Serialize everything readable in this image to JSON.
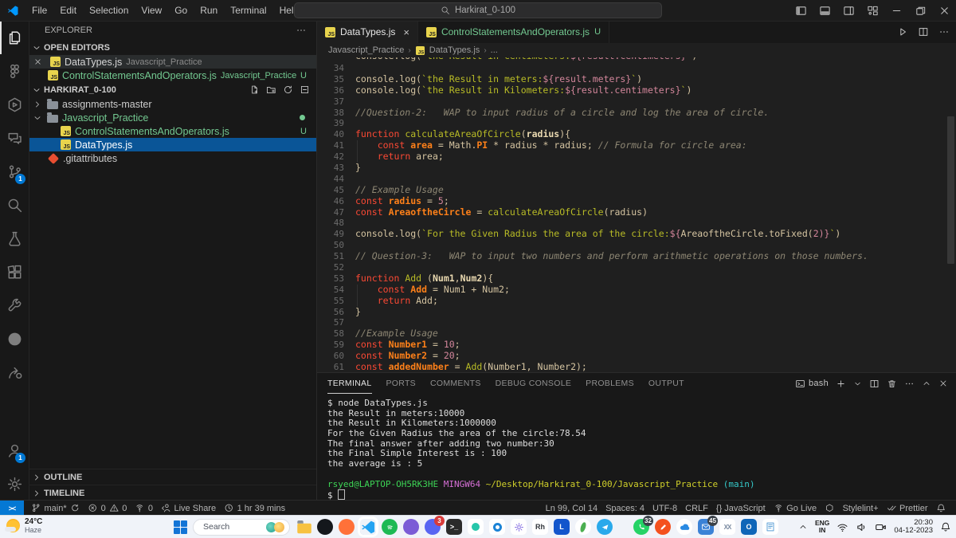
{
  "titlebar": {
    "menus": [
      "File",
      "Edit",
      "Selection",
      "View",
      "Go",
      "Run",
      "Terminal",
      "Help"
    ],
    "back_arrow": "←",
    "forward_arrow": "→",
    "search": "Harkirat_0-100"
  },
  "activity_bar": {
    "items": [
      {
        "name": "explorer",
        "icon": "files",
        "active": true
      },
      {
        "name": "figma",
        "icon": "figma"
      },
      {
        "name": "hexagon-app",
        "icon": "hexagon"
      },
      {
        "name": "chat",
        "icon": "chat"
      },
      {
        "name": "source-control",
        "icon": "scm",
        "badge": "1"
      },
      {
        "name": "search",
        "icon": "search"
      },
      {
        "name": "testing",
        "icon": "beaker"
      },
      {
        "name": "extensions",
        "icon": "extensions"
      },
      {
        "name": "remote-tools",
        "icon": "tools"
      },
      {
        "name": "github",
        "icon": "github"
      },
      {
        "name": "live-share",
        "icon": "share"
      }
    ],
    "bottom": [
      {
        "name": "accounts",
        "icon": "account",
        "badge": "1"
      },
      {
        "name": "settings",
        "icon": "gear"
      }
    ]
  },
  "sidebar": {
    "title": "EXPLORER",
    "open_editors": {
      "label": "OPEN EDITORS",
      "items": [
        {
          "file": "DataTypes.js",
          "desc": "Javascript_Practice",
          "closable": true,
          "green": false,
          "badge": ""
        },
        {
          "file": "ControlStatementsAndOperators.js",
          "desc": "Javascript_Practice",
          "closable": false,
          "green": true,
          "badge": "U"
        }
      ]
    },
    "workspace": {
      "label": "HARKIRAT_0-100",
      "tree": [
        {
          "label": "assignments-master",
          "kind": "folder",
          "chev": "r",
          "indent": 4
        },
        {
          "label": "Javascript_Practice",
          "kind": "folder",
          "chev": "d",
          "indent": 4,
          "green": true,
          "dot": true
        },
        {
          "label": "ControlStatementsAndOperators.js",
          "kind": "js",
          "indent": 40,
          "green": true,
          "badge": "U"
        },
        {
          "label": "DataTypes.js",
          "kind": "js",
          "indent": 40,
          "selected": true
        },
        {
          "label": ".gitattributes",
          "kind": "git",
          "indent": 24
        }
      ]
    },
    "outline_label": "OUTLINE",
    "timeline_label": "TIMELINE"
  },
  "editor": {
    "tabs": [
      {
        "label": "DataTypes.js",
        "active": true,
        "close": "×",
        "green": false,
        "badge": ""
      },
      {
        "label": "ControlStatementsAndOperators.js",
        "active": false,
        "close": "",
        "green": true,
        "badge": "U"
      }
    ],
    "breadcrumbs": [
      "Javascript_Practice",
      "DataTypes.js",
      "..."
    ],
    "code": [
      {
        "n": "",
        "clip": true,
        "seg": [
          [
            "console.log(",
            "pl"
          ],
          [
            "`the Result in centimeters:",
            "st"
          ],
          [
            "${result.centimeters}",
            "tp"
          ],
          [
            "`)",
            "pl"
          ]
        ]
      },
      {
        "n": 34,
        "seg": []
      },
      {
        "n": 35,
        "seg": [
          [
            "console.log(",
            "pl"
          ],
          [
            "`the Result in meters:",
            "st"
          ],
          [
            "${result.meters}",
            "tp"
          ],
          [
            "`",
            "st"
          ],
          [
            ")",
            "pl"
          ]
        ]
      },
      {
        "n": 36,
        "seg": [
          [
            "console.log(",
            "pl"
          ],
          [
            "`the Result in Kilometers:",
            "st"
          ],
          [
            "${result.centimeters}",
            "tp"
          ],
          [
            "`",
            "st"
          ],
          [
            ")",
            "pl"
          ]
        ]
      },
      {
        "n": 37,
        "seg": []
      },
      {
        "n": 38,
        "seg": [
          [
            "//Question-2:   WAP to input radius of a circle and log the area of circle.",
            "cm"
          ]
        ]
      },
      {
        "n": 39,
        "seg": []
      },
      {
        "n": 40,
        "seg": [
          [
            "function",
            "kw"
          ],
          [
            " ",
            "pl"
          ],
          [
            "calculateAreaOfCircle",
            "fn"
          ],
          [
            "(",
            "pl"
          ],
          [
            "radius",
            "pr"
          ],
          [
            "){",
            "pl"
          ]
        ]
      },
      {
        "n": 41,
        "g": true,
        "seg": [
          [
            "    ",
            "pl"
          ],
          [
            "const",
            "kw"
          ],
          [
            " ",
            "pl"
          ],
          [
            "area",
            "vr"
          ],
          [
            " = ",
            "pl"
          ],
          [
            "Math.",
            "pl"
          ],
          [
            "PI",
            "vr"
          ],
          [
            " * radius * radius; ",
            "pl"
          ],
          [
            "// Formula for circle area:",
            "cm"
          ]
        ]
      },
      {
        "n": 42,
        "g": true,
        "seg": [
          [
            "    ",
            "pl"
          ],
          [
            "return",
            "kw"
          ],
          [
            " area;",
            "pl"
          ]
        ]
      },
      {
        "n": 43,
        "seg": [
          [
            "}",
            "pl"
          ]
        ]
      },
      {
        "n": 44,
        "seg": []
      },
      {
        "n": 45,
        "seg": [
          [
            "// Example Usage",
            "cm"
          ]
        ]
      },
      {
        "n": 46,
        "seg": [
          [
            "const",
            "kw"
          ],
          [
            " ",
            "pl"
          ],
          [
            "radius",
            "vr"
          ],
          [
            " = ",
            "pl"
          ],
          [
            "5",
            "nm"
          ],
          [
            ";",
            "pl"
          ]
        ]
      },
      {
        "n": 47,
        "seg": [
          [
            "const",
            "kw"
          ],
          [
            " ",
            "pl"
          ],
          [
            "AreaoftheCircle",
            "vr"
          ],
          [
            " = ",
            "pl"
          ],
          [
            "calculateAreaOfCircle",
            "fn"
          ],
          [
            "(radius)",
            "pl"
          ]
        ]
      },
      {
        "n": 48,
        "seg": []
      },
      {
        "n": 49,
        "seg": [
          [
            "console.log(",
            "pl"
          ],
          [
            "`For the Given Radius the area of the circle:",
            "st"
          ],
          [
            "${",
            "tp"
          ],
          [
            "AreaoftheCircle.toFixed(",
            "pl"
          ],
          [
            "2",
            "nm"
          ],
          [
            ")}",
            "tp"
          ],
          [
            "`",
            "st"
          ],
          [
            ")",
            "pl"
          ]
        ]
      },
      {
        "n": 50,
        "seg": []
      },
      {
        "n": 51,
        "seg": [
          [
            "// Question-3:   WAP to input two numbers and perform arithmetic operations on those numbers.",
            "cm"
          ]
        ]
      },
      {
        "n": 52,
        "seg": []
      },
      {
        "n": 53,
        "seg": [
          [
            "function",
            "kw"
          ],
          [
            " ",
            "pl"
          ],
          [
            "Add",
            "fn"
          ],
          [
            " (",
            "pl"
          ],
          [
            "Num1",
            "pr"
          ],
          [
            ",",
            "pl"
          ],
          [
            "Num2",
            "pr"
          ],
          [
            "){",
            "pl"
          ]
        ]
      },
      {
        "n": 54,
        "g": true,
        "seg": [
          [
            "    ",
            "pl"
          ],
          [
            "const",
            "kw"
          ],
          [
            " ",
            "pl"
          ],
          [
            "Add",
            "vr"
          ],
          [
            " = Num1 + Num2;",
            "pl"
          ]
        ]
      },
      {
        "n": 55,
        "g": true,
        "seg": [
          [
            "    ",
            "pl"
          ],
          [
            "return",
            "kw"
          ],
          [
            " Add;",
            "pl"
          ]
        ]
      },
      {
        "n": 56,
        "seg": [
          [
            "}",
            "pl"
          ]
        ]
      },
      {
        "n": 57,
        "seg": []
      },
      {
        "n": 58,
        "seg": [
          [
            "//Example Usage",
            "cm"
          ]
        ]
      },
      {
        "n": 59,
        "seg": [
          [
            "const",
            "kw"
          ],
          [
            " ",
            "pl"
          ],
          [
            "Number1",
            "vr"
          ],
          [
            " = ",
            "pl"
          ],
          [
            "10",
            "nm"
          ],
          [
            ";",
            "pl"
          ]
        ]
      },
      {
        "n": 60,
        "seg": [
          [
            "const",
            "kw"
          ],
          [
            " ",
            "pl"
          ],
          [
            "Number2",
            "vr"
          ],
          [
            " = ",
            "pl"
          ],
          [
            "20",
            "nm"
          ],
          [
            ";",
            "pl"
          ]
        ]
      },
      {
        "n": 61,
        "seg": [
          [
            "const",
            "kw"
          ],
          [
            " ",
            "pl"
          ],
          [
            "addedNumber",
            "vr"
          ],
          [
            " = ",
            "pl"
          ],
          [
            "Add",
            "fn"
          ],
          [
            "(Number1, Number2);",
            "pl"
          ]
        ]
      }
    ]
  },
  "terminal": {
    "tabs": [
      "TERMINAL",
      "PORTS",
      "COMMENTS",
      "DEBUG CONSOLE",
      "PROBLEMS",
      "OUTPUT"
    ],
    "active_tab": "TERMINAL",
    "shell_label": "bash",
    "lines": [
      {
        "seg": [
          [
            "$ node DataTypes.js",
            "t"
          ]
        ]
      },
      {
        "seg": [
          [
            "the Result in meters:10000",
            "t"
          ]
        ]
      },
      {
        "seg": [
          [
            "the Result in Kilometers:1000000",
            "t"
          ]
        ]
      },
      {
        "seg": [
          [
            "For the Given Radius the area of the circle:78.54",
            "t"
          ]
        ]
      },
      {
        "seg": [
          [
            "The final answer after adding two number:30",
            "t"
          ]
        ]
      },
      {
        "seg": [
          [
            "the Final Simple Interest is : 100",
            "t"
          ]
        ]
      },
      {
        "seg": [
          [
            "the average is : 5",
            "t"
          ]
        ]
      },
      {
        "seg": []
      },
      {
        "seg": [
          [
            "rsyed@LAPTOP-OH5RK3HE ",
            "user"
          ],
          [
            "MINGW64 ",
            "host"
          ],
          [
            "~/Desktop/Harkirat_0-100/Javascript_Practice ",
            "path"
          ],
          [
            "(main)",
            "branch"
          ]
        ]
      },
      {
        "seg": [
          [
            "$ ",
            "t"
          ],
          [
            "",
            "cursor"
          ]
        ]
      }
    ]
  },
  "status_bar": {
    "remote_glyph": "><",
    "left": [
      {
        "name": "git-branch",
        "parts": [
          {
            "i": "branch"
          },
          {
            "t": "main*"
          },
          {
            "i": "sync"
          }
        ]
      },
      {
        "name": "problems",
        "parts": [
          {
            "i": "error"
          },
          {
            "t": "0"
          },
          {
            "i": "warn"
          },
          {
            "t": "0"
          }
        ]
      },
      {
        "name": "ports",
        "parts": [
          {
            "i": "broadcast2"
          },
          {
            "t": "0"
          }
        ]
      },
      {
        "name": "live-share",
        "parts": [
          {
            "i": "liveshare"
          },
          {
            "t": "Live Share"
          }
        ]
      },
      {
        "name": "time-tracker",
        "parts": [
          {
            "i": "clock"
          },
          {
            "t": "1 hr 39 mins"
          }
        ]
      }
    ],
    "right": [
      {
        "name": "cursor-position",
        "parts": [
          {
            "t": "Ln 99, Col 14"
          }
        ]
      },
      {
        "name": "indentation",
        "parts": [
          {
            "t": "Spaces: 4"
          }
        ]
      },
      {
        "name": "encoding",
        "parts": [
          {
            "t": "UTF-8"
          }
        ]
      },
      {
        "name": "eol",
        "parts": [
          {
            "t": "CRLF"
          }
        ]
      },
      {
        "name": "language-mode",
        "parts": [
          {
            "t": "{} JavaScript"
          }
        ]
      },
      {
        "name": "go-live",
        "parts": [
          {
            "i": "broadcast"
          },
          {
            "t": "Go Live"
          }
        ]
      },
      {
        "name": "eslint",
        "parts": [
          {
            "i": "hex"
          }
        ]
      },
      {
        "name": "stylelint",
        "parts": [
          {
            "t": "Stylelint+"
          }
        ]
      },
      {
        "name": "prettier",
        "parts": [
          {
            "i": "checkcheck"
          },
          {
            "t": "Prettier"
          }
        ]
      },
      {
        "name": "notifications",
        "parts": [
          {
            "i": "bell"
          }
        ]
      }
    ]
  },
  "taskbar": {
    "weather": {
      "temp": "24°C",
      "desc": "Haze"
    },
    "search_placeholder": "Search",
    "center_icons": [
      {
        "name": "file-explorer",
        "style": "folder"
      },
      {
        "name": "github-desktop-dark",
        "bg": "#14171c",
        "round": true
      },
      {
        "name": "firefox",
        "bg": "#ff7139",
        "round": true
      },
      {
        "name": "vscode",
        "style": "vscode",
        "active": true
      },
      {
        "name": "spotify",
        "bg": "#1db954",
        "round": true,
        "style": "arcs"
      },
      {
        "name": "github-purple",
        "bg": "#7b5cd6",
        "round": true
      },
      {
        "name": "discord",
        "bg": "#5865f2",
        "round": true,
        "badge": "3",
        "badge_bg": "#d83b3b"
      },
      {
        "name": "terminal-app",
        "bg": "#2b2b2b",
        "glyph": ">_"
      },
      {
        "name": "teal-dot-app",
        "bg": "#ffffff",
        "style": "dotteal"
      },
      {
        "name": "blue-swirl-app",
        "bg": "#ffffff",
        "style": "swirl"
      },
      {
        "name": "settings-app",
        "bg": "#ffffff",
        "style": "gearpurple"
      },
      {
        "name": "rh-app",
        "bg": "#ffffff",
        "glyph": "Rh",
        "fg": "#30343b"
      },
      {
        "name": "l-app",
        "bg": "#1255cc",
        "glyph": "L",
        "fg": "#ffffff"
      },
      {
        "name": "mongodb",
        "bg": "#ffffff",
        "style": "leaf",
        "round": true
      },
      {
        "name": "telegram",
        "bg": "#29a9eb",
        "round": true,
        "style": "send"
      }
    ],
    "right_icons": [
      {
        "name": "whatsapp",
        "bg": "#25d366",
        "round": true,
        "style": "phone",
        "badge": "32",
        "badge_bg": "#3a4149"
      },
      {
        "name": "pen-app",
        "bg": "#f4511e",
        "round": true,
        "style": "pencil"
      },
      {
        "name": "cloud-app",
        "bg": "#ffffff",
        "round": true,
        "style": "cloudblue"
      },
      {
        "name": "mail",
        "bg": "#3b82d6",
        "style": "mail",
        "badge": "45",
        "badge_bg": "#3a4149"
      },
      {
        "name": "xx-app",
        "bg": "#ffffff",
        "glyph": "XX",
        "fg": "#7a8aa0"
      },
      {
        "name": "outlook",
        "bg": "#1066b8",
        "glyph": "O",
        "fg": "#ffffff"
      },
      {
        "name": "notes-app",
        "bg": "#ffffff",
        "style": "notes"
      }
    ],
    "tray": {
      "lang": "ENG",
      "region": "IN",
      "time": "20:30",
      "date": "04-12-2023"
    }
  }
}
